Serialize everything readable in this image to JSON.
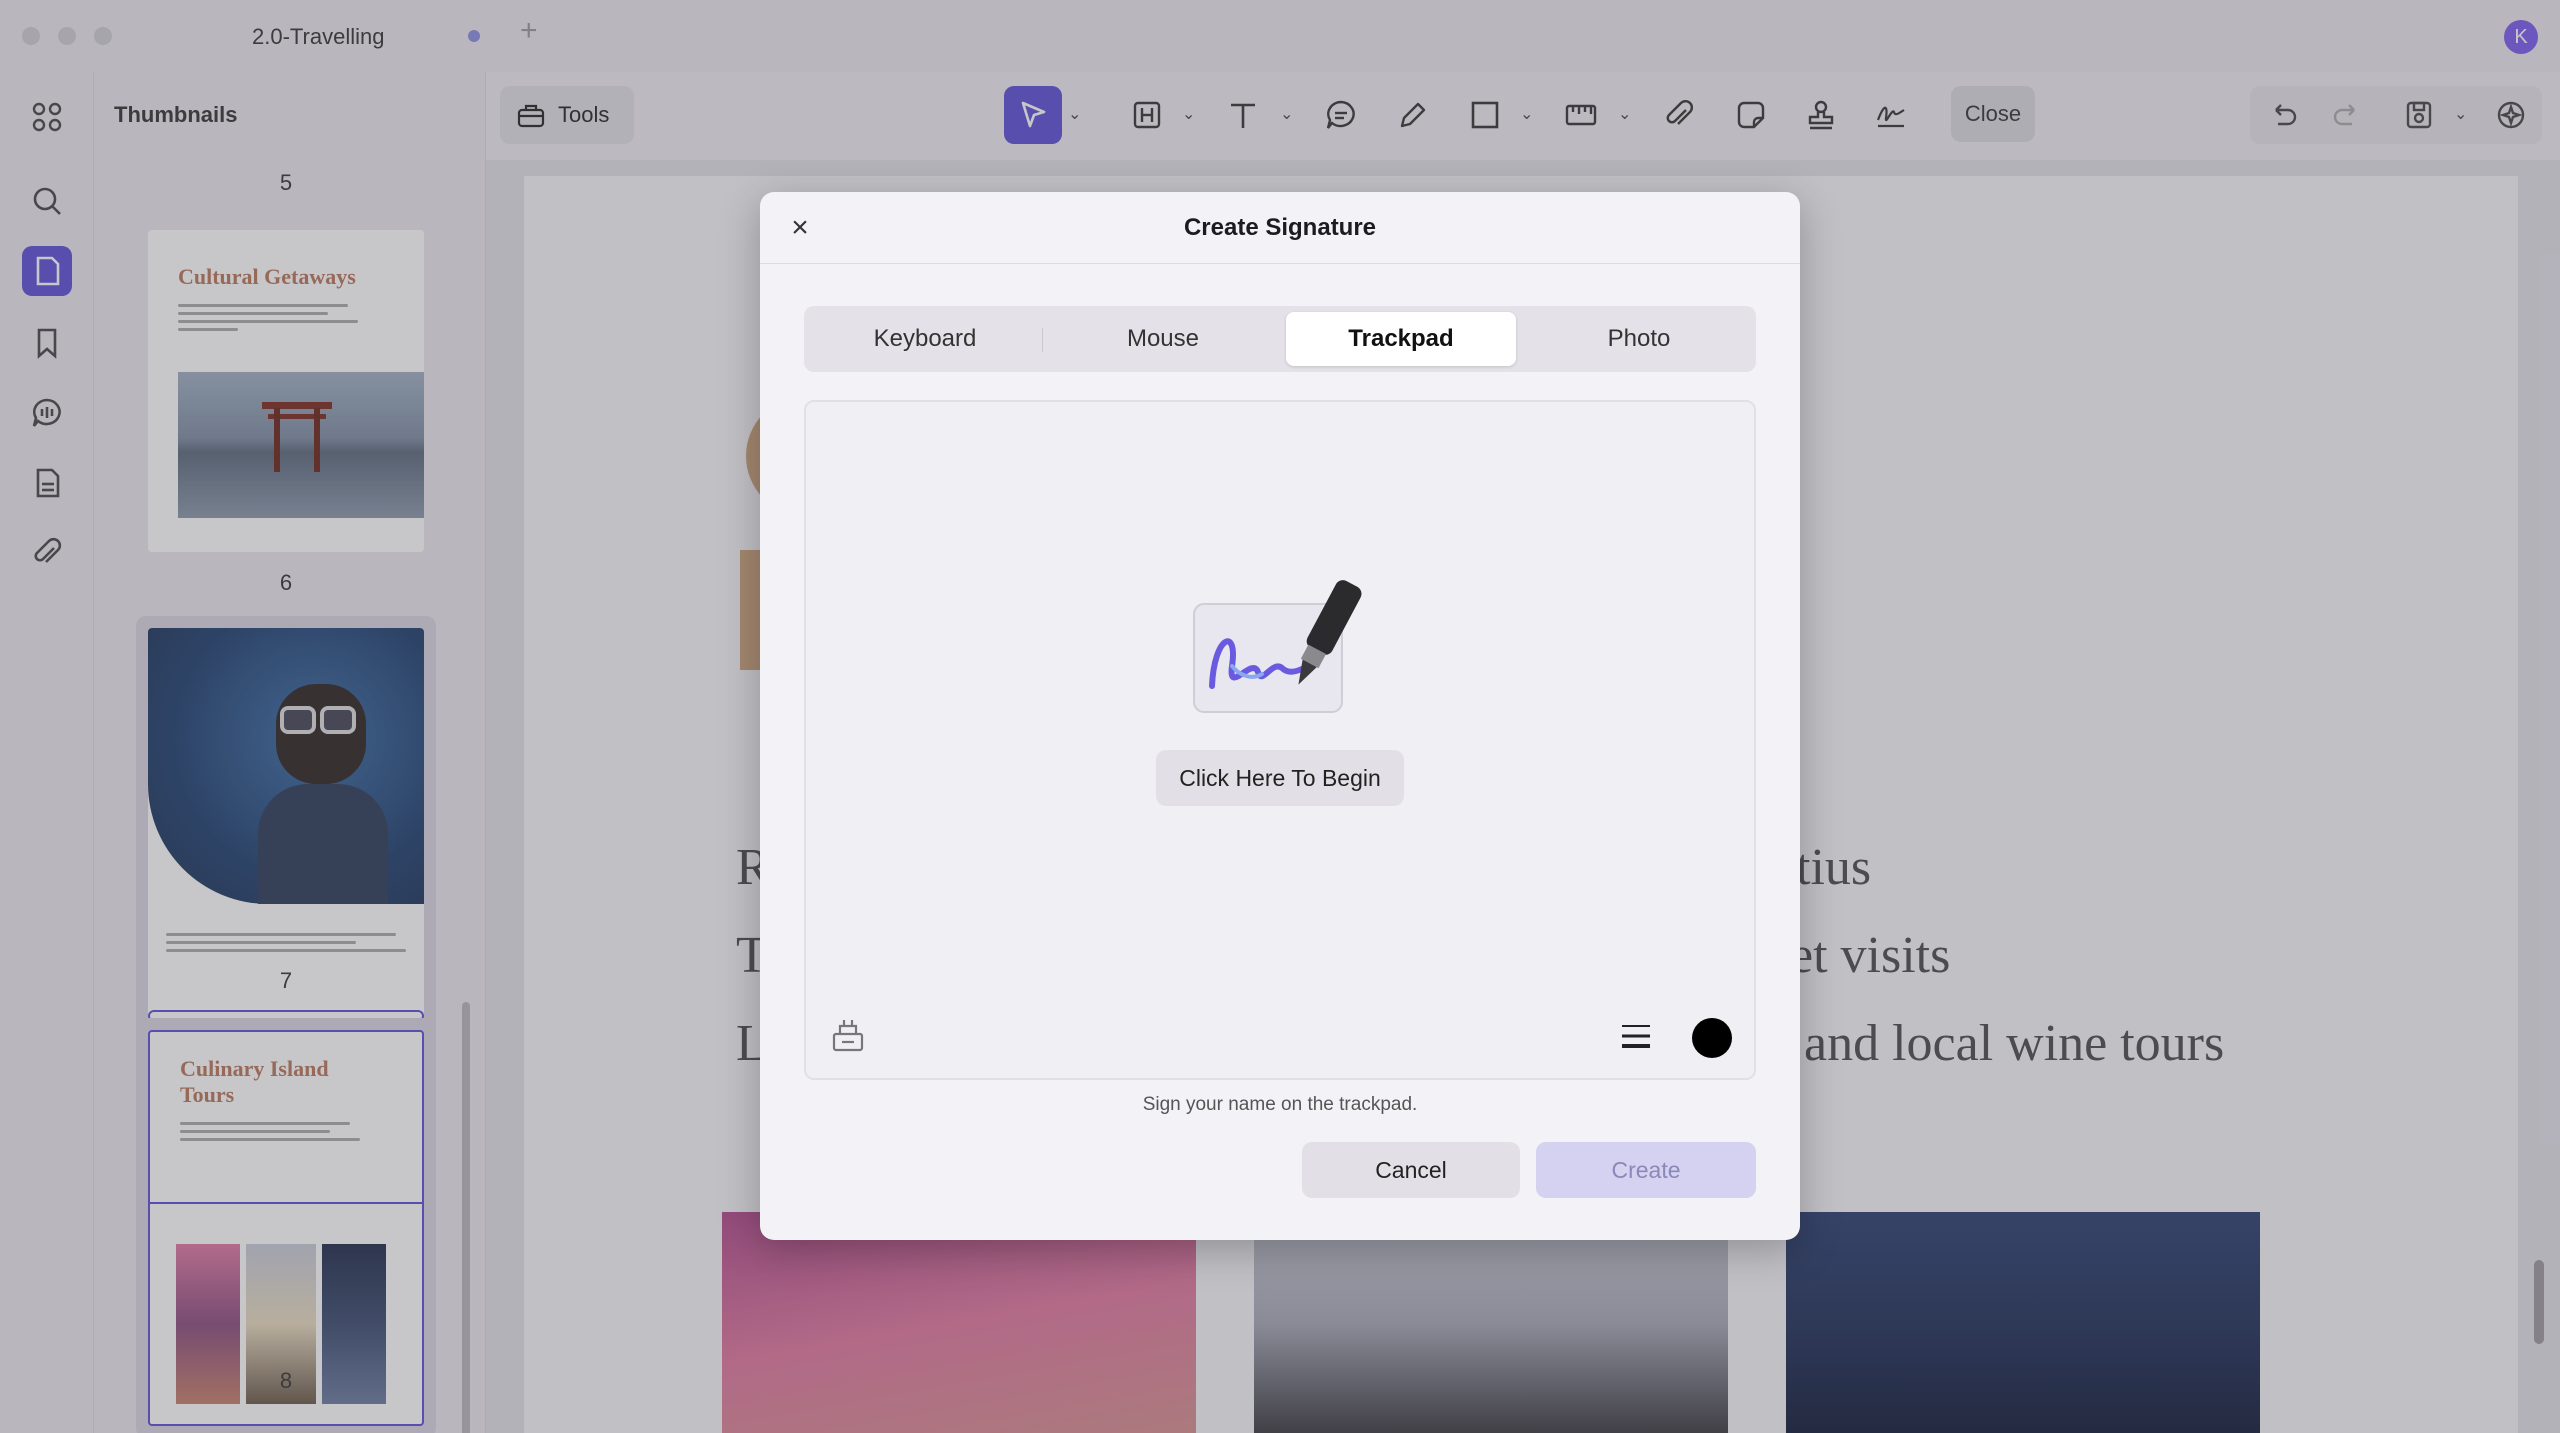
{
  "window": {
    "tab_title": "2.0-Travelling",
    "avatar_letter": "K"
  },
  "sidebar_panel": {
    "title": "Thumbnails",
    "pages": [
      {
        "number": "5"
      },
      {
        "number": "6",
        "heading": "Cultural Getaways"
      },
      {
        "number": "7"
      },
      {
        "number": "8",
        "heading": "Culinary Island Tours"
      }
    ]
  },
  "toolbar": {
    "tools_label": "Tools",
    "close_label": "Close"
  },
  "document": {
    "lines": [
      {
        "left": "R",
        "right": "tius"
      },
      {
        "left": "T",
        "right": "et visits"
      },
      {
        "left": "L",
        "right": "and local wine tours"
      }
    ]
  },
  "dialog": {
    "title": "Create Signature",
    "tabs": [
      {
        "label": "Keyboard",
        "active": false
      },
      {
        "label": "Mouse",
        "active": false
      },
      {
        "label": "Trackpad",
        "active": true
      },
      {
        "label": "Photo",
        "active": false
      }
    ],
    "begin_label": "Click Here To Begin",
    "hint": "Sign your name on the trackpad.",
    "ink_color": "#000000",
    "cancel_label": "Cancel",
    "create_label": "Create"
  },
  "colors": {
    "accent": "#5a4fd8"
  }
}
